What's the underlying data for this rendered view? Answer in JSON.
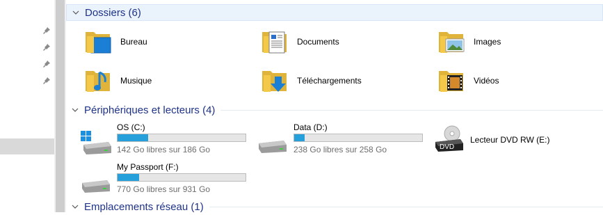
{
  "groups": {
    "folders": {
      "title": "Dossiers (6)"
    },
    "devices": {
      "title": "Périphériques et lecteurs (4)"
    },
    "network": {
      "title": "Emplacements réseau (1)"
    }
  },
  "folders": [
    {
      "label": "Bureau",
      "icon": "desktop-folder-icon"
    },
    {
      "label": "Documents",
      "icon": "documents-folder-icon"
    },
    {
      "label": "Images",
      "icon": "pictures-folder-icon"
    },
    {
      "label": "Musique",
      "icon": "music-folder-icon"
    },
    {
      "label": "Téléchargements",
      "icon": "downloads-folder-icon"
    },
    {
      "label": "Vidéos",
      "icon": "videos-folder-icon"
    }
  ],
  "drives": [
    {
      "name": "OS (C:)",
      "free_text": "142 Go libres sur 186 Go",
      "used_fraction": 0.24,
      "icon": "windows-drive-icon"
    },
    {
      "name": "Data (D:)",
      "free_text": "238 Go libres sur 258 Go",
      "used_fraction": 0.08,
      "icon": "hard-drive-icon"
    },
    {
      "name": "Lecteur DVD RW (E:)",
      "icon": "dvd-drive-icon",
      "badge": "DVD"
    },
    {
      "name": "My Passport (F:)",
      "free_text": "770 Go libres sur 931 Go",
      "used_fraction": 0.17,
      "icon": "hard-drive-icon"
    }
  ],
  "colors": {
    "header_text": "#1e3287",
    "progress_fill": "#26a0da",
    "folder_yellow": "#f4c94a"
  }
}
